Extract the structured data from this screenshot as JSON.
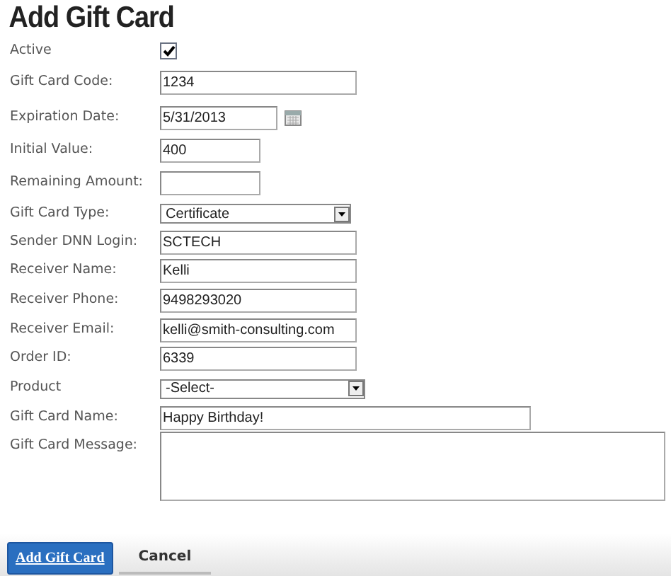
{
  "title": "Add Gift Card",
  "fields": [
    {
      "kind": "checkbox",
      "label": "Active",
      "checked": true
    },
    {
      "kind": "text",
      "label": "Gift Card Code:",
      "value": "1234"
    },
    {
      "kind": "date",
      "label": "Expiration Date:",
      "value": "5/31/2013"
    },
    {
      "kind": "text",
      "label": "Initial Value:",
      "value": "400"
    },
    {
      "kind": "text",
      "label": "Remaining Amount:"
    },
    {
      "kind": "select",
      "label": "Gift Card Type:",
      "value": "Certificate"
    },
    {
      "kind": "text",
      "label": "Sender DNN Login:",
      "value": "SCTECH"
    },
    {
      "kind": "text",
      "label": "Receiver Name:",
      "value": "Kelli"
    },
    {
      "kind": "text",
      "label": "Receiver Phone:",
      "value": "9498293020"
    },
    {
      "kind": "text",
      "label": "Receiver Email:",
      "value": "kelli@smith-consulting.com"
    },
    {
      "kind": "text",
      "label": "Order ID:",
      "value": "6339"
    },
    {
      "kind": "select",
      "label": "Product",
      "value": "-Select-"
    },
    {
      "kind": "text",
      "label": "Gift Card Name:",
      "value": "Happy Birthday!"
    },
    {
      "kind": "textarea",
      "label": "Gift Card Message:"
    }
  ],
  "buttons": [
    {
      "label": "Add Gift Card",
      "kind": "primary"
    },
    {
      "label": "Cancel",
      "kind": "secondary"
    }
  ]
}
